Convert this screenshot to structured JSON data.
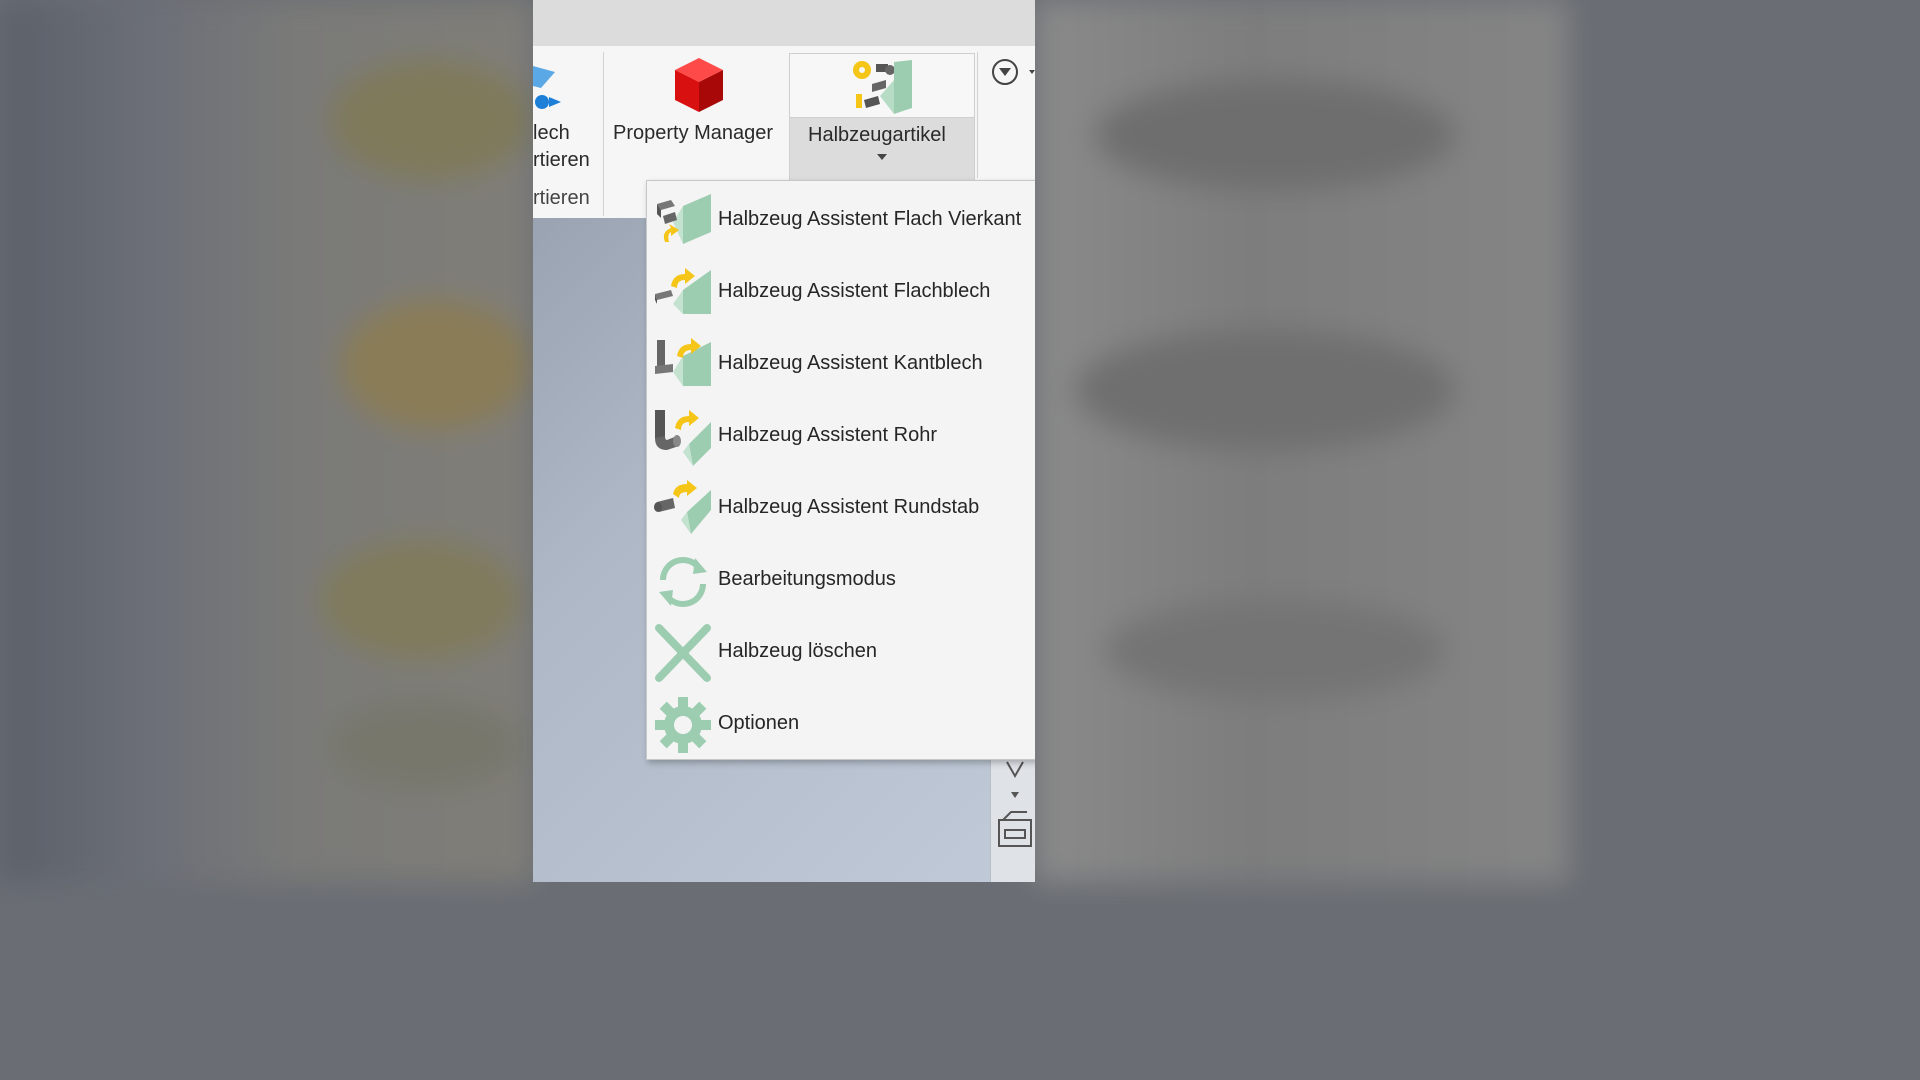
{
  "ribbon": {
    "left_group": {
      "line1": "lech",
      "line2": "rtieren",
      "group_label": "rtieren"
    },
    "property_manager": {
      "label": "Property Manager"
    },
    "halbzeugartikel": {
      "label": "Halbzeugartikel"
    }
  },
  "menu": {
    "items": [
      {
        "label": "Halbzeug Assistent  Flach Vierkant",
        "icon": "flat-square-wizard-icon"
      },
      {
        "label": "Halbzeug Assistent Flachblech",
        "icon": "flat-sheet-wizard-icon"
      },
      {
        "label": "Halbzeug Assistent Kantblech",
        "icon": "bent-sheet-wizard-icon"
      },
      {
        "label": "Halbzeug Assistent Rohr",
        "icon": "tube-wizard-icon"
      },
      {
        "label": "Halbzeug Assistent Rundstab",
        "icon": "round-bar-wizard-icon"
      },
      {
        "label": "Bearbeitungsmodus",
        "icon": "refresh-icon"
      },
      {
        "label": "Halbzeug löschen",
        "icon": "delete-x-icon"
      },
      {
        "label": "Optionen",
        "icon": "gear-icon"
      }
    ]
  },
  "colors": {
    "menu_icon_green": "#9ccdb0",
    "accent_yellow": "#f5c518",
    "cube_red": "#e01010"
  }
}
